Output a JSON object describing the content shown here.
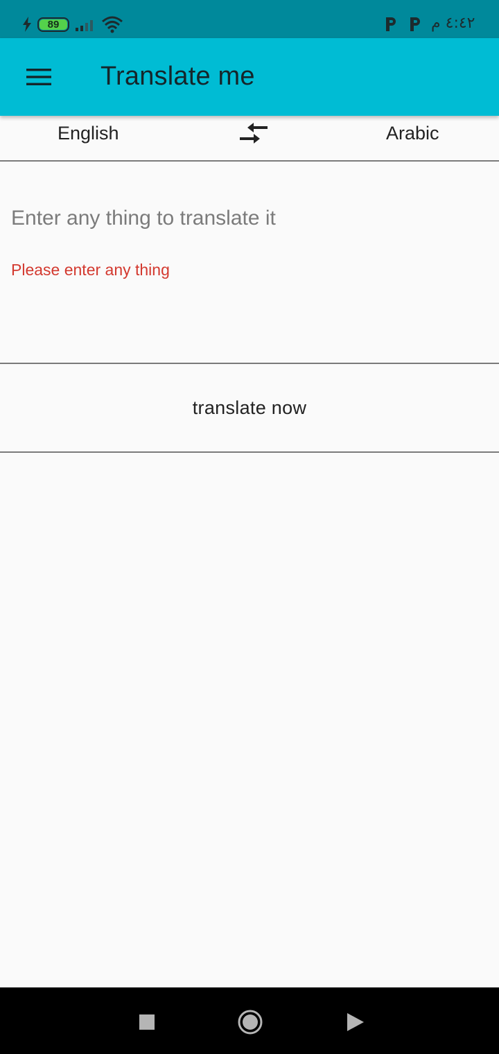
{
  "status_bar": {
    "battery_level": "89",
    "time": "٤:٤٢ م",
    "notification_icons": [
      "p-icon",
      "p-icon"
    ],
    "colors": {
      "background": "#00899b",
      "battery_fill": "#54d14b"
    }
  },
  "app_bar": {
    "title": "Translate me",
    "menu_icon": "hamburger-menu-icon",
    "color": "#00bcd4"
  },
  "language_selector": {
    "source": "English",
    "target": "Arabic",
    "swap_icon": "swap-arrows-icon"
  },
  "input": {
    "placeholder": "Enter any thing to translate it",
    "value": "",
    "error": "Please enter any thing",
    "error_color": "#d3392f"
  },
  "translate_button": {
    "label": "translate now"
  },
  "nav_bar": {
    "items": [
      "stop-square-icon",
      "home-circle-icon",
      "play-triangle-icon"
    ]
  }
}
